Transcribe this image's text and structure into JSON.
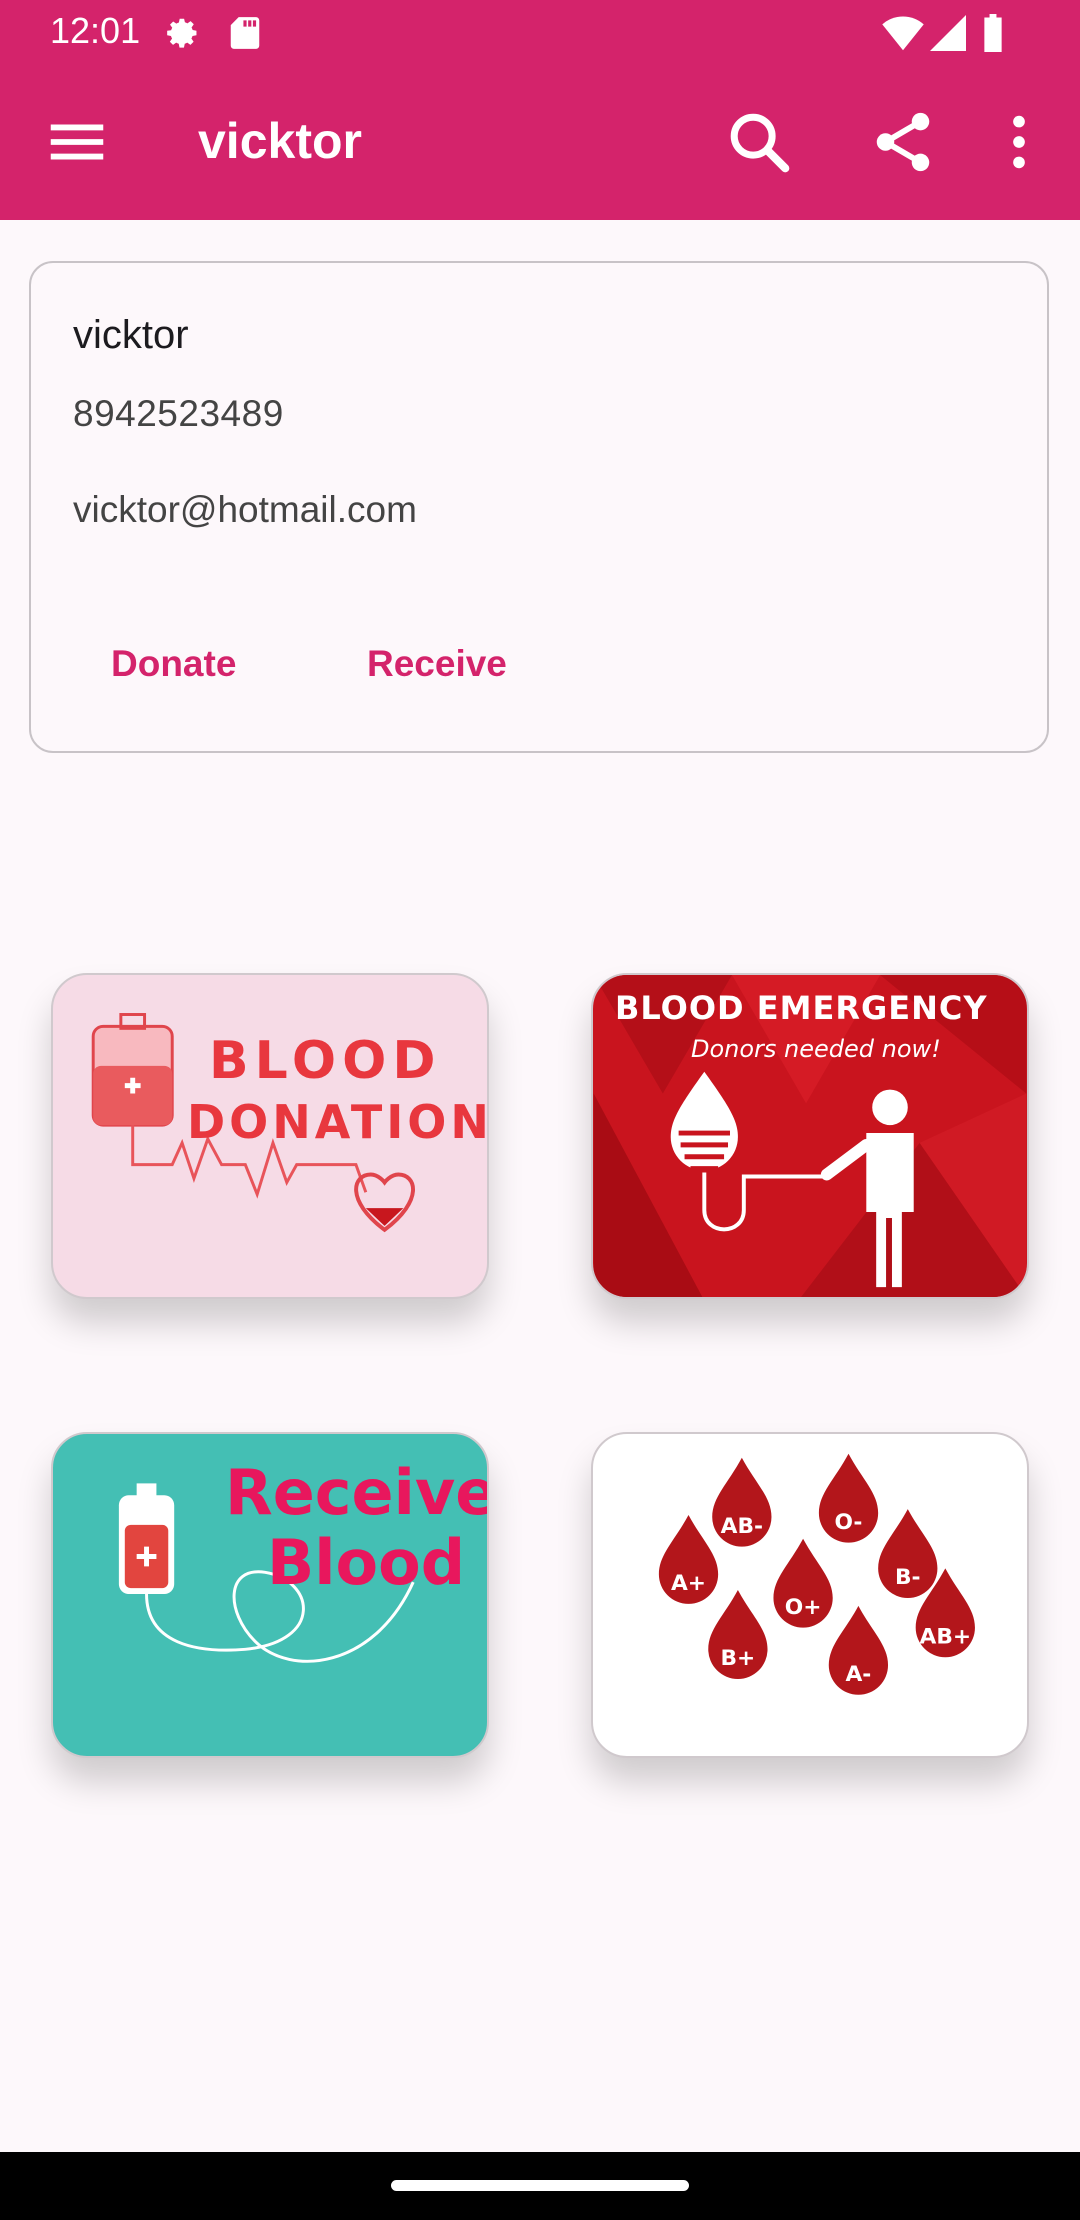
{
  "status_bar": {
    "time": "12:01"
  },
  "toolbar": {
    "title": "vicktor"
  },
  "profile_card": {
    "name": "vicktor",
    "phone": "8942523489",
    "email": "vicktor@hotmail.com",
    "donate_label": "Donate",
    "receive_label": "Receive"
  },
  "tiles": {
    "blood_donation": {
      "line1": "BLOOD",
      "line2": "DONATION"
    },
    "blood_emergency": {
      "title": "BLOOD EMERGENCY",
      "subtitle": "Donors needed now!"
    },
    "receive_blood": {
      "line1": "Receive",
      "line2": "Blood"
    },
    "blood_types": {
      "types": [
        "AB-",
        "O-",
        "B-",
        "A+",
        "O+",
        "AB+",
        "B+",
        "A-"
      ]
    }
  },
  "colors": {
    "app_bar": "#d4236b",
    "accent": "#d4236b",
    "donation_bg": "#f6dbe6",
    "emergency_bg": "#c9141e",
    "receive_bg": "#44bfb4",
    "blood_red": "#b3161b"
  },
  "icons": [
    "menu-icon",
    "search-icon",
    "share-icon",
    "more-vert-icon",
    "settings-icon",
    "sd-card-icon",
    "wifi-icon",
    "signal-icon",
    "battery-icon"
  ]
}
